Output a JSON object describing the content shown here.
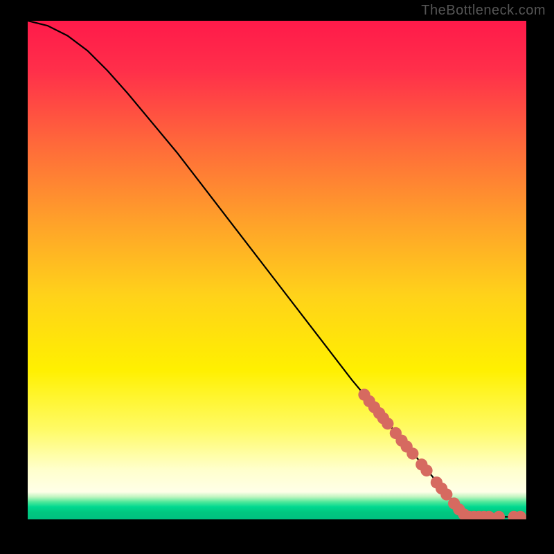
{
  "watermark": "TheBottleneck.com",
  "chart_data": {
    "type": "line",
    "title": "",
    "xlabel": "",
    "ylabel": "",
    "xlim": [
      0,
      100
    ],
    "ylim": [
      0,
      100
    ],
    "gradient_stops": [
      {
        "offset": 0.0,
        "color": "#ff1a4a"
      },
      {
        "offset": 0.1,
        "color": "#ff2f4a"
      },
      {
        "offset": 0.25,
        "color": "#ff6a3a"
      },
      {
        "offset": 0.4,
        "color": "#ffa02a"
      },
      {
        "offset": 0.55,
        "color": "#ffd21a"
      },
      {
        "offset": 0.7,
        "color": "#fff000"
      },
      {
        "offset": 0.82,
        "color": "#fffb66"
      },
      {
        "offset": 0.9,
        "color": "#ffffcc"
      },
      {
        "offset": 0.945,
        "color": "#ffffe8"
      },
      {
        "offset": 0.955,
        "color": "#bff5c0"
      },
      {
        "offset": 0.965,
        "color": "#4de89a"
      },
      {
        "offset": 0.975,
        "color": "#00d890"
      },
      {
        "offset": 0.985,
        "color": "#00c880"
      },
      {
        "offset": 1.0,
        "color": "#00c080"
      }
    ],
    "curve": [
      {
        "x": 0,
        "y": 100
      },
      {
        "x": 4,
        "y": 99
      },
      {
        "x": 8,
        "y": 97
      },
      {
        "x": 12,
        "y": 94
      },
      {
        "x": 16,
        "y": 90
      },
      {
        "x": 20,
        "y": 85.5
      },
      {
        "x": 25,
        "y": 79.5
      },
      {
        "x": 30,
        "y": 73.5
      },
      {
        "x": 35,
        "y": 67
      },
      {
        "x": 40,
        "y": 60.5
      },
      {
        "x": 45,
        "y": 54
      },
      {
        "x": 50,
        "y": 47.5
      },
      {
        "x": 55,
        "y": 41
      },
      {
        "x": 60,
        "y": 34.5
      },
      {
        "x": 65,
        "y": 28
      },
      {
        "x": 70,
        "y": 22
      },
      {
        "x": 75,
        "y": 16
      },
      {
        "x": 80,
        "y": 10
      },
      {
        "x": 85,
        "y": 4
      },
      {
        "x": 88,
        "y": 0.5
      },
      {
        "x": 100,
        "y": 0.5
      }
    ],
    "markers": [
      {
        "x": 67.5,
        "y": 25.0
      },
      {
        "x": 68.5,
        "y": 23.7
      },
      {
        "x": 69.5,
        "y": 22.5
      },
      {
        "x": 70.5,
        "y": 21.3
      },
      {
        "x": 71.3,
        "y": 20.3
      },
      {
        "x": 72.2,
        "y": 19.2
      },
      {
        "x": 73.8,
        "y": 17.3
      },
      {
        "x": 75.0,
        "y": 15.8
      },
      {
        "x": 76.0,
        "y": 14.6
      },
      {
        "x": 77.2,
        "y": 13.2
      },
      {
        "x": 79.0,
        "y": 11.0
      },
      {
        "x": 80.0,
        "y": 9.8
      },
      {
        "x": 82.0,
        "y": 7.4
      },
      {
        "x": 83.0,
        "y": 6.2
      },
      {
        "x": 84.0,
        "y": 5.0
      },
      {
        "x": 85.5,
        "y": 3.2
      },
      {
        "x": 86.5,
        "y": 2.0
      },
      {
        "x": 87.5,
        "y": 1.0
      },
      {
        "x": 88.5,
        "y": 0.5
      },
      {
        "x": 89.5,
        "y": 0.5
      },
      {
        "x": 90.5,
        "y": 0.5
      },
      {
        "x": 91.5,
        "y": 0.5
      },
      {
        "x": 92.5,
        "y": 0.5
      },
      {
        "x": 94.5,
        "y": 0.5
      },
      {
        "x": 97.5,
        "y": 0.5
      },
      {
        "x": 98.8,
        "y": 0.5
      }
    ],
    "marker_color": "#d66a60",
    "marker_radius_frac": 0.012
  }
}
